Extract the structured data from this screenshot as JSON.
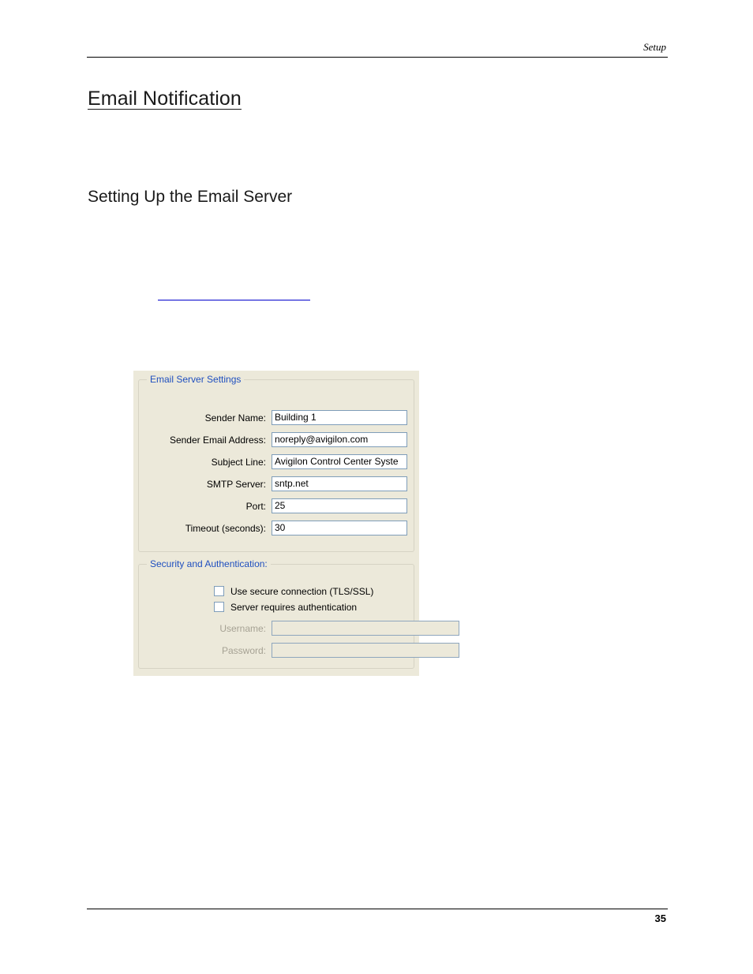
{
  "header": {
    "running_title": "Setup"
  },
  "headings": {
    "title": "Email Notification",
    "subtitle": "Setting Up the Email Server"
  },
  "cross_reference": {
    "text": ""
  },
  "dialog": {
    "server_group": {
      "legend": "Email Server Settings",
      "fields": [
        {
          "label": "Sender Name:",
          "value": "Building 1"
        },
        {
          "label": "Sender Email Address:",
          "value": "noreply@avigilon.com"
        },
        {
          "label": "Subject Line:",
          "value": "Avigilon Control Center Syste"
        },
        {
          "label": "SMTP Server:",
          "value": "sntp.net"
        },
        {
          "label": "Port:",
          "value": "25"
        },
        {
          "label": "Timeout (seconds):",
          "value": "30"
        }
      ]
    },
    "security_group": {
      "legend": "Security and Authentication:",
      "checkboxes": [
        {
          "label": "Use secure connection (TLS/SSL)",
          "checked": false
        },
        {
          "label": "Server requires authentication",
          "checked": false
        }
      ],
      "fields": [
        {
          "label": "Username:",
          "value": "",
          "disabled": true
        },
        {
          "label": "Password:",
          "value": "",
          "disabled": true
        }
      ]
    },
    "colors": {
      "panel_background": "#ece9da",
      "legend_text": "#1f4fbf",
      "input_border": "#7f9db9",
      "input_background": "#ffffff",
      "disabled_text": "#a6a294"
    }
  },
  "footer": {
    "page_number": "35"
  }
}
